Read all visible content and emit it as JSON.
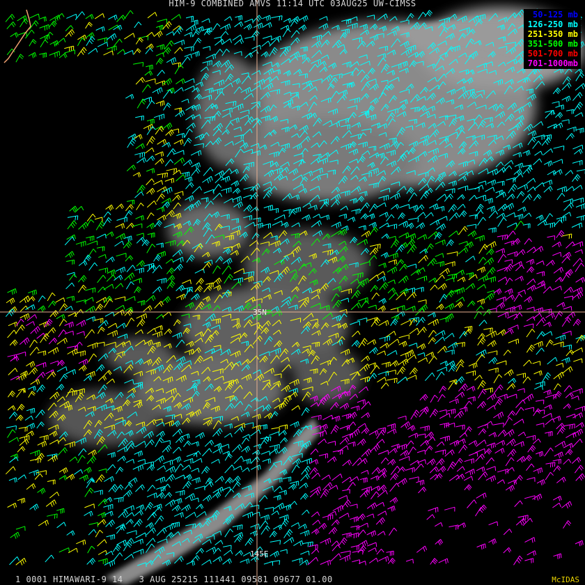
{
  "header": {
    "title": "HIM-9 COMBINED AMVS 11:14 UTC 03AUG25 UW-CIMSS"
  },
  "footer": {
    "info": "1 0001 HIMAWARI-9 14   3 AUG 25215 111441 09581 09677 01.00",
    "brand": "McIDAS"
  },
  "legend": [
    {
      "label": "50-125 mb",
      "color": "#0000ff"
    },
    {
      "label": "126-250 mb",
      "color": "#00ffff"
    },
    {
      "label": "251-350 mb",
      "color": "#ffff00"
    },
    {
      "label": "351-500 mb",
      "color": "#00ff00"
    },
    {
      "label": "501-700 mb",
      "color": "#ff0000"
    },
    {
      "label": "701-1000mb",
      "color": "#ff00ff"
    }
  ],
  "gridlines": {
    "lat_label": "35N",
    "lon_label": "145E",
    "line_color": "#e8b090"
  }
}
